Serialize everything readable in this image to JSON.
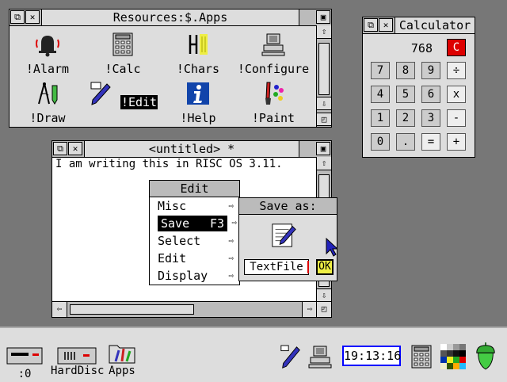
{
  "resources_window": {
    "title": "Resources:$.Apps",
    "icons": [
      {
        "label": "!Alarm",
        "icon": "alarm-bell-icon"
      },
      {
        "label": "!Calc",
        "icon": "calculator-icon"
      },
      {
        "label": "!Chars",
        "icon": "chars-icon"
      },
      {
        "label": "!Configure",
        "icon": "configure-icon"
      },
      {
        "label": "!Draw",
        "icon": "draw-compass-icon"
      },
      {
        "label": "!Edit",
        "icon": "edit-pen-icon"
      },
      {
        "label": "!Help",
        "icon": "help-info-icon"
      },
      {
        "label": "!Paint",
        "icon": "paint-palette-icon"
      }
    ]
  },
  "calculator": {
    "title": "Calculator",
    "display": "768",
    "clear_label": "C",
    "keys": [
      [
        "7",
        "8",
        "9",
        "÷"
      ],
      [
        "4",
        "5",
        "6",
        "x"
      ],
      [
        "1",
        "2",
        "3",
        "-"
      ],
      [
        "0",
        ".",
        "=",
        "+"
      ]
    ]
  },
  "edit_window": {
    "title": "<untitled> *",
    "text": "I am writing this in RISC OS 3.11."
  },
  "edit_menu": {
    "title": "Edit",
    "items": [
      {
        "label": "Misc",
        "shortcut": ""
      },
      {
        "label": "Save",
        "shortcut": "F3"
      },
      {
        "label": "Select",
        "shortcut": ""
      },
      {
        "label": "Edit",
        "shortcut": ""
      },
      {
        "label": "Display",
        "shortcut": ""
      }
    ]
  },
  "save_dialog": {
    "title": "Save as:",
    "filename": "TextFile",
    "ok_label": "OK"
  },
  "iconbar": {
    "left": [
      {
        "label": ":0",
        "icon": "floppy-drive-icon"
      },
      {
        "label": "HardDisc",
        "icon": "hard-disc-icon"
      },
      {
        "label": "Apps",
        "icon": "apps-folder-icon"
      }
    ],
    "clock": "19:13:16"
  },
  "colors": {
    "desktop": "#777777",
    "window_bg": "#dddddd",
    "title_bg": "#bbbbbb",
    "clock_border": "#0000ff",
    "clear_key": "#dd0000"
  }
}
